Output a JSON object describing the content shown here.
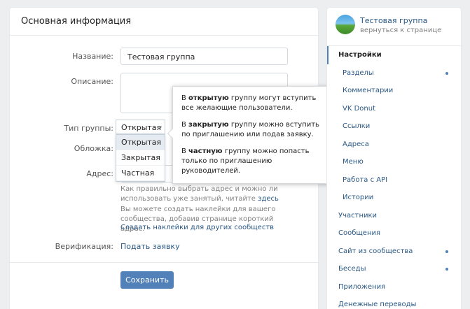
{
  "main": {
    "header": "Основная информация",
    "name_label": "Название:",
    "name_value": "Тестовая группа",
    "description_label": "Описание:",
    "group_type_label": "Тип группы:",
    "group_type_value": "Открытая",
    "cover_label": "Обложка:",
    "address_label": "Адрес:",
    "address_hint": "Как правильно выбрать адрес и можно ли использовать уже занятый, читайте",
    "address_hint_link": "здесь",
    "stickers_hint": "Вы можете создать наклейки для вашего сообщества, добавив странице короткий адрес.",
    "stickers_link": "Создать наклейки для других сообществ",
    "verification_label": "Верификация:",
    "verification_link": "Подать заявку",
    "save_button": "Сохранить"
  },
  "dropdown": {
    "options": [
      "Открытая",
      "Закрытая",
      "Частная"
    ],
    "selected_index": 0
  },
  "tooltip": {
    "open_pre": "В ",
    "open_bold": "открытую",
    "open_post": " группу могут вступить все желающие пользователи.",
    "closed_pre": "В ",
    "closed_bold": "закрытую",
    "closed_post": " группу можно вступить по приглашению или подав заявку.",
    "private_pre": "В ",
    "private_bold": "частную",
    "private_post": " группу можно попасть только по приглашению руководителей."
  },
  "sidebar": {
    "group_name": "Тестовая группа",
    "group_back": "вернуться к странице",
    "items": [
      {
        "label": "Настройки"
      },
      {
        "label": "Разделы"
      },
      {
        "label": "Комментарии"
      },
      {
        "label": "VK Donut"
      },
      {
        "label": "Ссылки"
      },
      {
        "label": "Адреса"
      },
      {
        "label": "Меню"
      },
      {
        "label": "Работа с API"
      },
      {
        "label": "Истории"
      },
      {
        "label": "Участники"
      },
      {
        "label": "Сообщения"
      },
      {
        "label": "Сайт из сообщества"
      },
      {
        "label": "Беседы"
      },
      {
        "label": "Приложения"
      },
      {
        "label": "Денежные переводы"
      }
    ]
  }
}
